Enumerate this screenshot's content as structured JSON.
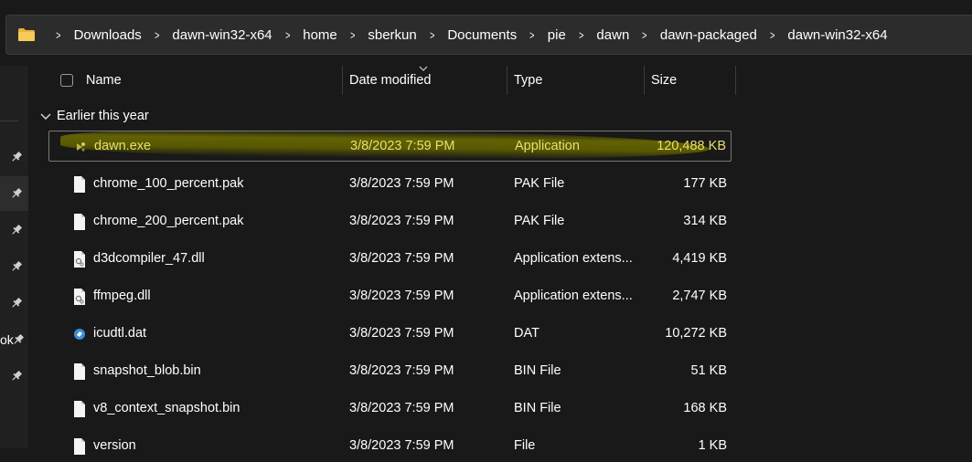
{
  "breadcrumb": [
    "Downloads",
    "dawn-win32-x64",
    "home",
    "sberkun",
    "Documents",
    "pie",
    "dawn",
    "dawn-packaged",
    "dawn-win32-x64"
  ],
  "nav": {
    "partial_label": "ok"
  },
  "columns": {
    "name": "Name",
    "date": "Date modified",
    "type": "Type",
    "size": "Size"
  },
  "group": {
    "label": "Earlier this year"
  },
  "files": [
    {
      "name": "dawn.exe",
      "date": "3/8/2023 7:59 PM",
      "type": "Application",
      "size": "120,488 KB",
      "icon": "app-exe-icon",
      "selected": true,
      "highlighted": true
    },
    {
      "name": "chrome_100_percent.pak",
      "date": "3/8/2023 7:59 PM",
      "type": "PAK File",
      "size": "177 KB",
      "icon": "file-icon"
    },
    {
      "name": "chrome_200_percent.pak",
      "date": "3/8/2023 7:59 PM",
      "type": "PAK File",
      "size": "314 KB",
      "icon": "file-icon"
    },
    {
      "name": "d3dcompiler_47.dll",
      "date": "3/8/2023 7:59 PM",
      "type": "Application extens...",
      "size": "4,419 KB",
      "icon": "dll-icon"
    },
    {
      "name": "ffmpeg.dll",
      "date": "3/8/2023 7:59 PM",
      "type": "Application extens...",
      "size": "2,747 KB",
      "icon": "dll-icon"
    },
    {
      "name": "icudtl.dat",
      "date": "3/8/2023 7:59 PM",
      "type": "DAT",
      "size": "10,272 KB",
      "icon": "dat-icon"
    },
    {
      "name": "snapshot_blob.bin",
      "date": "3/8/2023 7:59 PM",
      "type": "BIN File",
      "size": "51 KB",
      "icon": "file-icon"
    },
    {
      "name": "v8_context_snapshot.bin",
      "date": "3/8/2023 7:59 PM",
      "type": "BIN File",
      "size": "168 KB",
      "icon": "file-icon"
    },
    {
      "name": "version",
      "date": "3/8/2023 7:59 PM",
      "type": "File",
      "size": "1 KB",
      "icon": "file-icon"
    }
  ],
  "colors": {
    "background": "#191919",
    "highlight_text": "#e8e06a",
    "highlight_marker": "#6e6e00"
  }
}
